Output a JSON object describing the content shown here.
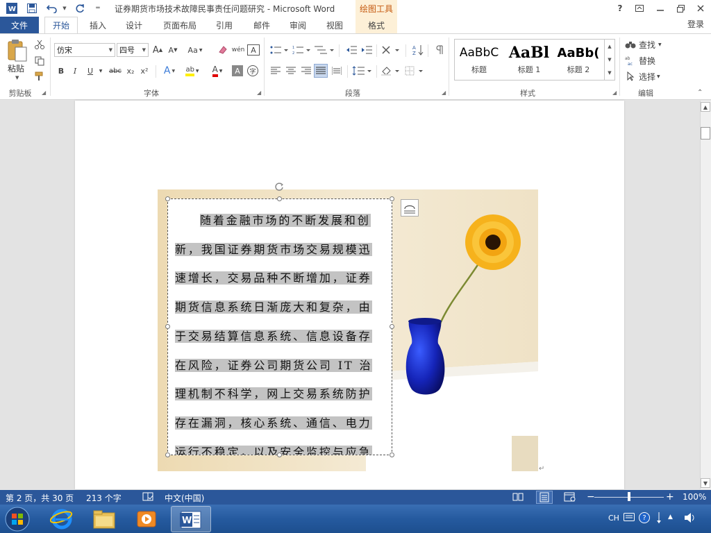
{
  "titlebar": {
    "title": "证券期货市场技术故障民事责任问题研究 - Microsoft Word",
    "context_tab_group": "绘图工具",
    "help": "?"
  },
  "tabs": [
    {
      "label": "文件"
    },
    {
      "label": "开始"
    },
    {
      "label": "插入"
    },
    {
      "label": "设计"
    },
    {
      "label": "页面布局"
    },
    {
      "label": "引用"
    },
    {
      "label": "邮件"
    },
    {
      "label": "审阅"
    },
    {
      "label": "视图"
    },
    {
      "label": "格式"
    }
  ],
  "login": "登录",
  "ribbon": {
    "clipboard": {
      "paste": "粘贴",
      "label": "剪贴板"
    },
    "font": {
      "font_name": "仿宋",
      "font_size": "四号",
      "label": "字体",
      "bold": "B",
      "italic": "I",
      "underline": "U",
      "strike": "abc",
      "subscript": "x₂",
      "superscript": "x²",
      "grow": "A",
      "shrink": "A",
      "case": "Aa",
      "phonetic": "wén",
      "border": "A",
      "effects": "A",
      "highlight": "ab",
      "color": "A",
      "shade": "A",
      "enclose": "字"
    },
    "paragraph": {
      "label": "段落"
    },
    "styles": {
      "label": "样式",
      "items": [
        {
          "sample": "AaBbC",
          "name": "标题"
        },
        {
          "sample": "AaBl",
          "name": "标题 1"
        },
        {
          "sample": "AaBb(",
          "name": "标题 2"
        }
      ]
    },
    "editing": {
      "label": "编辑",
      "find": "查找",
      "replace": "替换",
      "select": "选择"
    }
  },
  "document": {
    "textbox_text": "随着金融市场的不断发展和创新，我国证券期货市场交易规模迅速增长，交易品种不断增加，证券期货信息系统日渐庞大和复杂，由于交易结算信息系统、信息设备存在风险，证券公司期货公司 IT 治理机制不科学，网上交易系统防护存在漏洞，核心系统、通信、电力运行不稳定，以及安全监控与应急预案配合不够完善等"
  },
  "statusbar": {
    "page": "第 2 页，共 30 页",
    "words": "213 个字",
    "language": "中文(中国)",
    "zoom": "100%",
    "zoom_level": 0.5
  },
  "taskbar": {
    "ime": "CH"
  },
  "colors": {
    "accent": "#2b579a",
    "context": "#c55a11",
    "context_bg": "#fdf0d7",
    "selection": "#c3c3c3"
  }
}
